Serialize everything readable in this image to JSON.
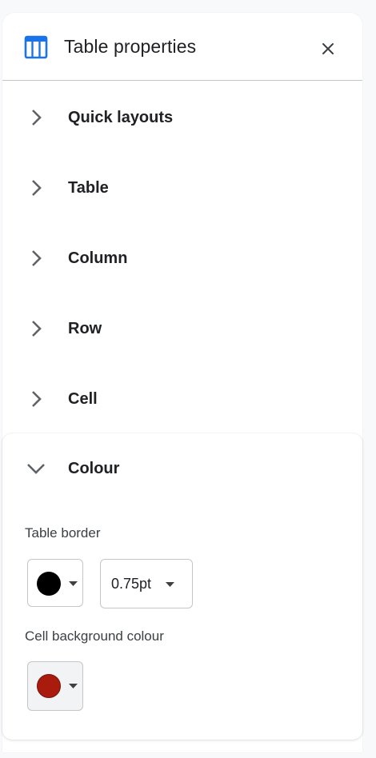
{
  "header": {
    "title": "Table properties",
    "icon": "table-icon",
    "close_icon": "close-icon"
  },
  "sections": [
    {
      "label": "Quick layouts",
      "expanded": false
    },
    {
      "label": "Table",
      "expanded": false
    },
    {
      "label": "Column",
      "expanded": false
    },
    {
      "label": "Row",
      "expanded": false
    },
    {
      "label": "Cell",
      "expanded": false
    }
  ],
  "colour": {
    "label": "Colour",
    "expanded": true,
    "table_border_label": "Table border",
    "border_color": "#000000",
    "border_weight": "0.75pt",
    "cell_bg_label": "Cell background colour",
    "cell_bg_color": "#a91b0d"
  },
  "colors": {
    "accent": "#1a73e8"
  }
}
